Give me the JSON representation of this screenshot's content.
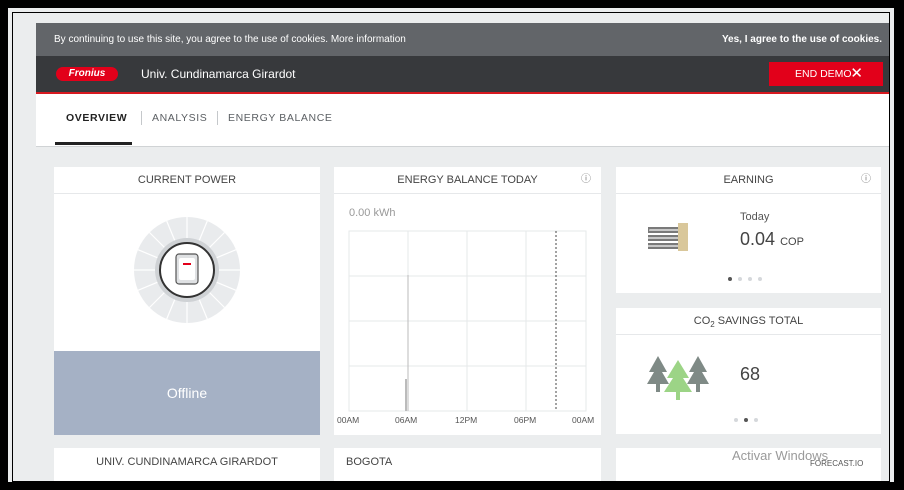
{
  "cookie_bar": {
    "message": "By continuing to use this site, you agree to the use of cookies. More information",
    "agree_label": "Yes, I agree to the use of cookies."
  },
  "header": {
    "logo_text": "Fronius",
    "site_name": "Univ. Cundinamarca Girardot",
    "end_demo_label": "END DEMO",
    "close_symbol": "✕"
  },
  "tabs": [
    {
      "label": "OVERVIEW",
      "active": true
    },
    {
      "label": "ANALYSIS",
      "active": false
    },
    {
      "label": "ENERGY BALANCE",
      "active": false
    }
  ],
  "current_power": {
    "title": "CURRENT POWER",
    "status": "Offline"
  },
  "energy_balance": {
    "title": "ENERGY BALANCE TODAY",
    "info_icon": "ⓘ",
    "total": "0.00 kWh",
    "x_labels": [
      "00AM",
      "06AM",
      "12PM",
      "06PM",
      "00AM"
    ]
  },
  "earning": {
    "title": "EARNING",
    "info_icon": "ⓘ",
    "period": "Today",
    "value": "0.04",
    "unit": "COP"
  },
  "co2": {
    "title": "CO2 SAVINGS TOTAL",
    "title_main": "CO",
    "title_sub": "2",
    "title_rest": " SAVINGS TOTAL",
    "value": "68"
  },
  "bottom_cards": {
    "left_title": "UNIV. CUNDINAMARCA GIRARDOT",
    "middle_title": "BOGOTA",
    "forecast_label": "FORECAST.IO"
  },
  "windows_watermark": "Activar Windows",
  "chart_data": {
    "type": "bar",
    "x_labels": [
      "00AM",
      "06AM",
      "12PM",
      "06PM",
      "00AM"
    ],
    "values": [],
    "title": "ENERGY BALANCE TODAY"
  }
}
